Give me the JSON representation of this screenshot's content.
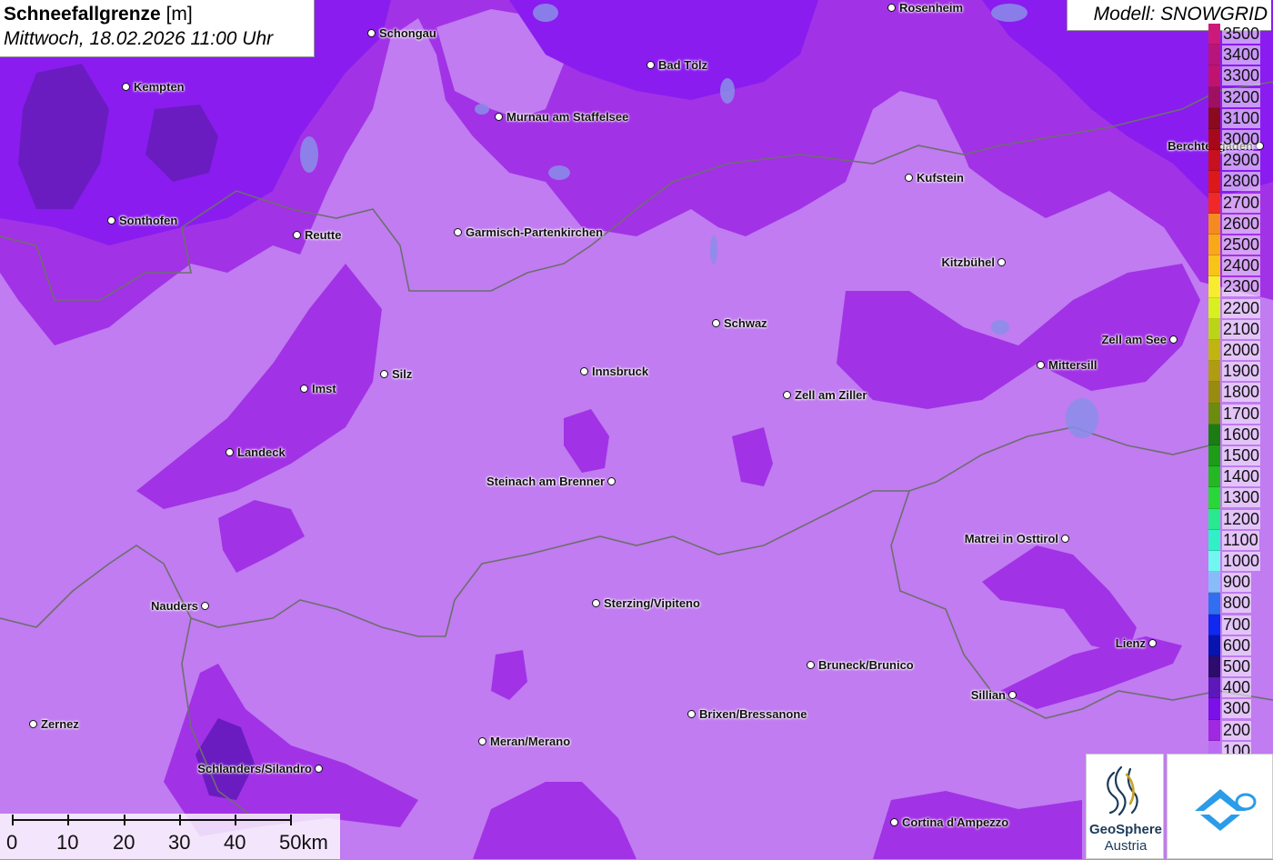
{
  "header": {
    "title_bold": "Schneefallgrenze",
    "title_unit": "[m]",
    "datetime": "Mittwoch, 18.02.2026 11:00 Uhr",
    "model": "Modell: SNOWGRID"
  },
  "legend": {
    "items": [
      {
        "label": "3500",
        "color": "#cc1a7a"
      },
      {
        "label": "3400",
        "color": "#b8157a"
      },
      {
        "label": "3300",
        "color": "#c01370"
      },
      {
        "label": "3200",
        "color": "#a01060"
      },
      {
        "label": "3100",
        "color": "#8a0a1e"
      },
      {
        "label": "3000",
        "color": "#a8091a"
      },
      {
        "label": "2900",
        "color": "#c8101e"
      },
      {
        "label": "2800",
        "color": "#dc1818"
      },
      {
        "label": "2700",
        "color": "#f02828"
      },
      {
        "label": "2600",
        "color": "#f48a20"
      },
      {
        "label": "2500",
        "color": "#f8a818"
      },
      {
        "label": "2400",
        "color": "#f8c418"
      },
      {
        "label": "2300",
        "color": "#f8ec30"
      },
      {
        "label": "2200",
        "color": "#d8f020"
      },
      {
        "label": "2100",
        "color": "#bcd418"
      },
      {
        "label": "2000",
        "color": "#c0b410"
      },
      {
        "label": "1900",
        "color": "#b09c10"
      },
      {
        "label": "1800",
        "color": "#988c10"
      },
      {
        "label": "1700",
        "color": "#6c8c10"
      },
      {
        "label": "1600",
        "color": "#1c7c14"
      },
      {
        "label": "1500",
        "color": "#1c9c18"
      },
      {
        "label": "1400",
        "color": "#24b824"
      },
      {
        "label": "1300",
        "color": "#28d838"
      },
      {
        "label": "1200",
        "color": "#28e890"
      },
      {
        "label": "1100",
        "color": "#30f0c8"
      },
      {
        "label": "1000",
        "color": "#70f8f0"
      },
      {
        "label": "900",
        "color": "#88bcf8"
      },
      {
        "label": "800",
        "color": "#3070f0"
      },
      {
        "label": "700",
        "color": "#1028f0"
      },
      {
        "label": "600",
        "color": "#0814b0"
      },
      {
        "label": "500",
        "color": "#2c0c6c"
      },
      {
        "label": "400",
        "color": "#5c18b8"
      },
      {
        "label": "300",
        "color": "#7c10e8"
      },
      {
        "label": "200",
        "color": "#a028e0"
      },
      {
        "label": "100",
        "color": "#bc6cf4"
      }
    ]
  },
  "cities": [
    {
      "name": "Rosenheim",
      "side": "right"
    },
    {
      "name": "Schongau",
      "side": "right"
    },
    {
      "name": "Bad Tölz",
      "side": "right"
    },
    {
      "name": "Kempten",
      "side": "right"
    },
    {
      "name": "Murnau am Staffelsee",
      "side": "right"
    },
    {
      "name": "Berchtesgaden",
      "side": "left"
    },
    {
      "name": "Kufstein",
      "side": "right"
    },
    {
      "name": "Sonthofen",
      "side": "right"
    },
    {
      "name": "Reutte",
      "side": "right"
    },
    {
      "name": "Garmisch-Partenkirchen",
      "side": "right"
    },
    {
      "name": "Kitzbühel",
      "side": "left"
    },
    {
      "name": "Schwaz",
      "side": "right"
    },
    {
      "name": "Zell am See",
      "side": "left"
    },
    {
      "name": "Mittersill",
      "side": "right"
    },
    {
      "name": "Innsbruck",
      "side": "right"
    },
    {
      "name": "Silz",
      "side": "right"
    },
    {
      "name": "Imst",
      "side": "right"
    },
    {
      "name": "Zell am Ziller",
      "side": "right"
    },
    {
      "name": "Landeck",
      "side": "right"
    },
    {
      "name": "Steinach am Brenner",
      "side": "left"
    },
    {
      "name": "Matrei in Osttirol",
      "side": "left"
    },
    {
      "name": "Nauders",
      "side": "left"
    },
    {
      "name": "Sterzing/Vipiteno",
      "side": "right"
    },
    {
      "name": "Lienz",
      "side": "left"
    },
    {
      "name": "Bruneck/Brunico",
      "side": "right"
    },
    {
      "name": "Sillian",
      "side": "left"
    },
    {
      "name": "Brixen/Bressanone",
      "side": "right"
    },
    {
      "name": "Zernez",
      "side": "right"
    },
    {
      "name": "Meran/Merano",
      "side": "right"
    },
    {
      "name": "Schlanders/Silandro",
      "side": "left"
    },
    {
      "name": "Cortina d'Ampezzo",
      "side": "right"
    }
  ],
  "scale": {
    "labels": [
      "0",
      "10",
      "20",
      "30",
      "40",
      "50km"
    ]
  },
  "logos": {
    "geosphere_line1": "GeoSphere",
    "geosphere_line2": "Austria"
  },
  "colors": {
    "base_100m": "#c07cf0",
    "band_200m": "#a232e6",
    "band_300m": "#8a1cf0",
    "band_400m": "#6a1cc0",
    "border": "#6e6e6e",
    "lakes": "#8a8ee8"
  }
}
